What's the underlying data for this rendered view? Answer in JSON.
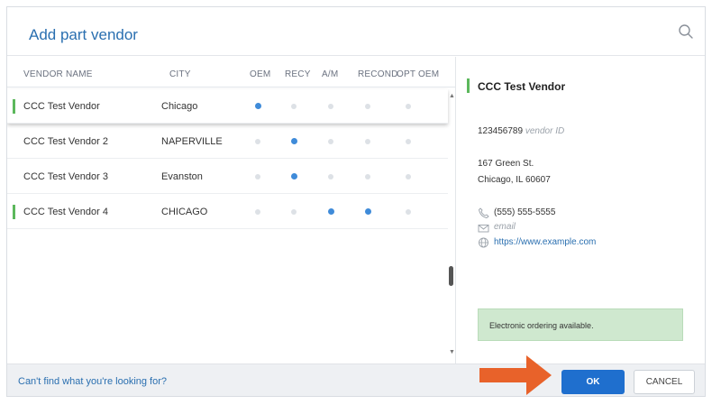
{
  "dialog": {
    "title": "Add part vendor",
    "search_icon": "search-icon"
  },
  "columns": {
    "vendor_name": "VENDOR NAME",
    "city": "CITY",
    "oem": "OEM",
    "recy": "RECY",
    "am": "A/M",
    "recond": "RECOND",
    "opt_oem": "OPT OEM"
  },
  "vendors": [
    {
      "name": "CCC Test Vendor",
      "city": "Chicago",
      "has_bar": true,
      "selected": true,
      "flags": {
        "oem": true,
        "recy": false,
        "am": false,
        "recond": false,
        "opt_oem": false
      }
    },
    {
      "name": "CCC Test Vendor 2",
      "city": "NAPERVILLE",
      "has_bar": false,
      "selected": false,
      "flags": {
        "oem": false,
        "recy": true,
        "am": false,
        "recond": false,
        "opt_oem": false
      }
    },
    {
      "name": "CCC Test Vendor 3",
      "city": "Evanston",
      "has_bar": false,
      "selected": false,
      "flags": {
        "oem": false,
        "recy": true,
        "am": false,
        "recond": false,
        "opt_oem": false
      }
    },
    {
      "name": "CCC Test Vendor 4",
      "city": "CHICAGO",
      "has_bar": true,
      "selected": false,
      "flags": {
        "oem": false,
        "recy": false,
        "am": true,
        "recond": true,
        "opt_oem": false
      }
    }
  ],
  "detail": {
    "name": "CCC Test Vendor",
    "vendor_id": "123456789",
    "vendor_id_label": "vendor ID",
    "address_line1": "167 Green St.",
    "address_line2": "Chicago, IL 60607",
    "phone": "(555) 555-5555",
    "email": "email",
    "website": "https://www.example.com",
    "notice": "Electronic ordering available."
  },
  "footer": {
    "cant_find": "Can't find what you're looking for?",
    "ok_label": "OK",
    "cancel_label": "CANCEL"
  },
  "colors": {
    "accent": "#1f6fce",
    "title": "#2a6fb0",
    "status_bar": "#5cb85c",
    "dot_on": "#3f8bd9",
    "dot_off": "#dde1e6",
    "notice_bg": "#cfe8cf",
    "arrow": "#e8622a"
  }
}
